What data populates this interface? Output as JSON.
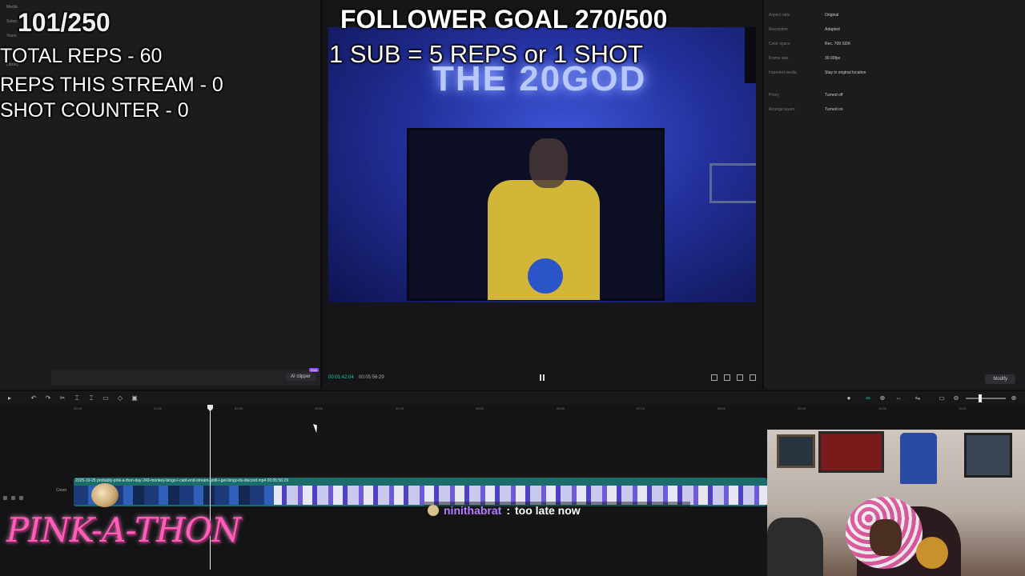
{
  "editor": {
    "left_nav": [
      "Media",
      "Subsc",
      "Yours",
      "AI media",
      "Library"
    ],
    "ai_clipper_label": "AI clipper",
    "ai_clipper_tag": "Free",
    "preview": {
      "current_time": "00:01:42:04",
      "total_time": "00:05:56:29",
      "sign_text": "THE 20GOD"
    },
    "properties": [
      {
        "label": "Aspect ratio",
        "value": "Original"
      },
      {
        "label": "Resolution",
        "value": "Adapted"
      },
      {
        "label": "Color space",
        "value": "Rec. 709 SDR"
      },
      {
        "label": "Frame rate",
        "value": "30.00fps"
      },
      {
        "label": "Imported media",
        "value": "Stay in original location"
      },
      {
        "label": "Proxy",
        "value": "Turned off"
      },
      {
        "label": "Arrange layers",
        "value": "Turned on"
      }
    ],
    "modify_label": "Modify",
    "timeline": {
      "ruler_ticks": [
        "00:00",
        "01:00",
        "02:00",
        "03:00",
        "04:00",
        "05:00",
        "06:00",
        "07:00",
        "08:00",
        "09:00",
        "10:00",
        "11:00"
      ],
      "clip_label": "2025-10-25 probably-pink-a-thon-day-243-monkey-bingo-i-cant-end-stream-until-i-get-bingo-its-discord.mp4  00:05:56:29",
      "cover_label": "Cover"
    }
  },
  "overlay": {
    "counter_top": "101/250",
    "total_reps": "TOTAL REPS - 60",
    "reps_stream": "REPS THIS STREAM - 0",
    "shot_counter": "SHOT COUNTER - 0",
    "follower_goal": "FOLLOWER GOAL 270/500",
    "sub_rule": "1 SUB = 5 REPS or 1 SHOT",
    "logo": "PINK-A-THON"
  },
  "chat": {
    "username": "ninithabrat",
    "separator": ":",
    "message": "too late now"
  },
  "colors": {
    "accent_teal": "#21c4b5",
    "clip_teal": "#1a6d6a",
    "chat_username": "#b77cff",
    "logo_pink": "#ff5db8"
  }
}
